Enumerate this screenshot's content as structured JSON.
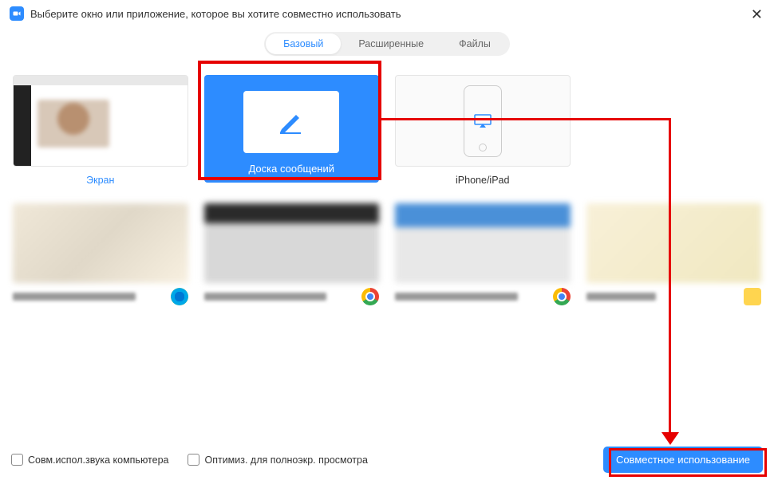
{
  "header": {
    "title": "Выберите окно или приложение, которое вы хотите совместно использовать",
    "close_icon": "✕"
  },
  "tabs": {
    "basic": "Базовый",
    "advanced": "Расширенные",
    "files": "Файлы"
  },
  "options": {
    "screen": "Экран",
    "whiteboard": "Доска сообщений",
    "iphone": "iPhone/iPad"
  },
  "footer": {
    "share_audio": "Совм.испол.звука компьютера",
    "optimize": "Оптимиз. для полноэкр. просмотра",
    "share_button": "Совместное использование"
  }
}
